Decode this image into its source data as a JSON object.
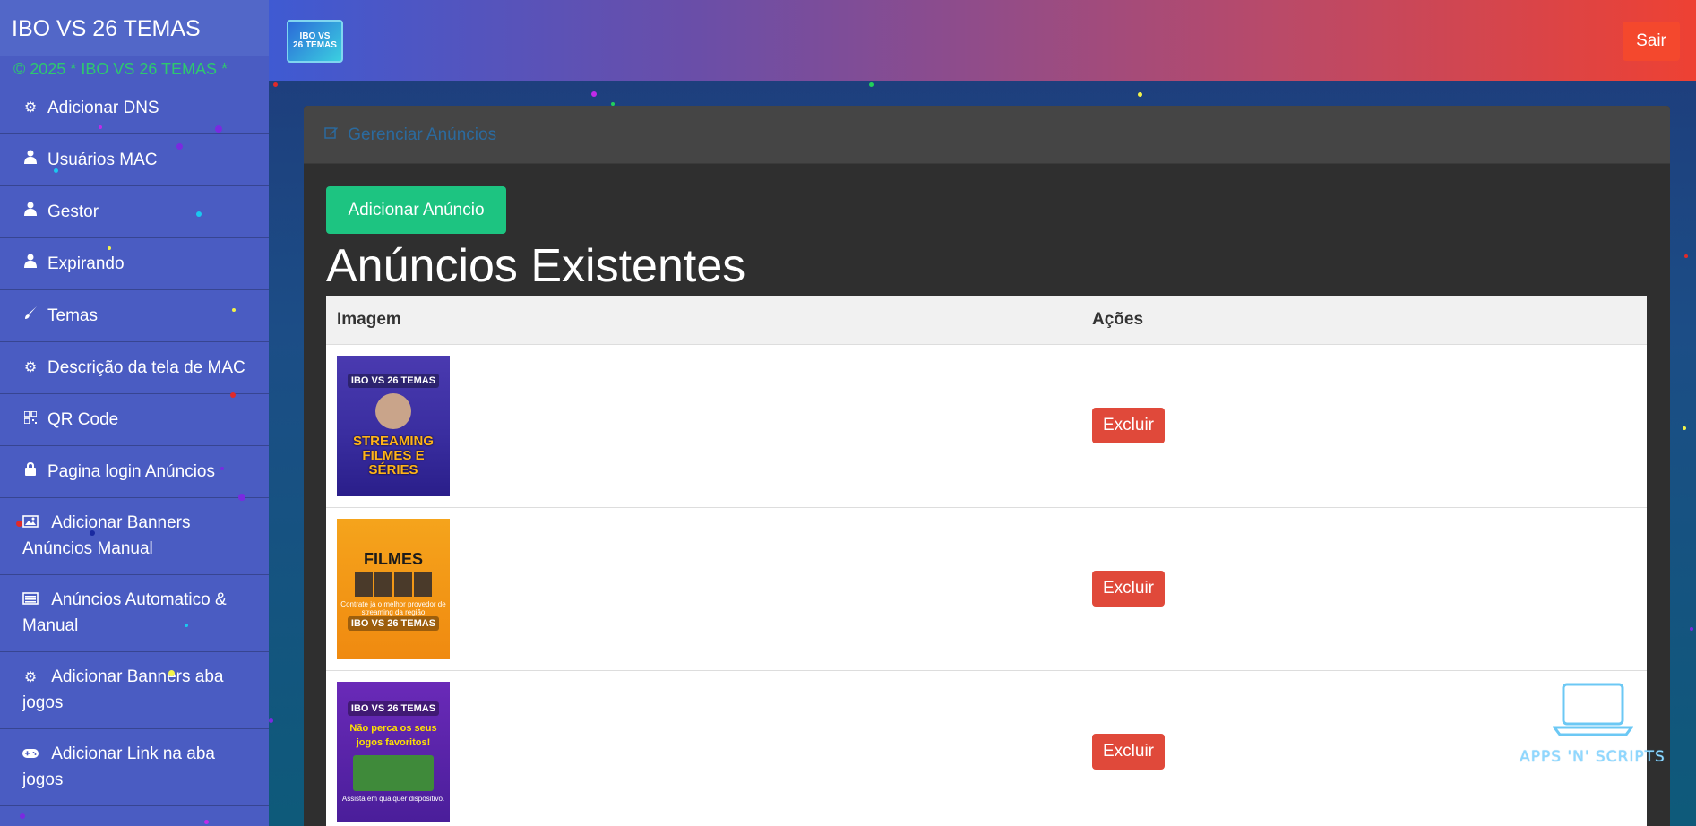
{
  "sidebar": {
    "brand_title": "IBO VS 26 TEMAS",
    "copyright": "© 2025 * IBO VS 26 TEMAS *",
    "items": [
      {
        "label": "Adicionar DNS",
        "icon": "gears-icon"
      },
      {
        "label": "Usuários MAC",
        "icon": "user-icon"
      },
      {
        "label": "Gestor",
        "icon": "user-icon"
      },
      {
        "label": "Expirando",
        "icon": "user-icon"
      },
      {
        "label": "Temas",
        "icon": "brush-icon"
      },
      {
        "label": "Descrição da tela de MAC",
        "icon": "gear-icon"
      },
      {
        "label": "QR Code",
        "icon": "qrcode-icon"
      },
      {
        "label": "Pagina login Anúncios",
        "icon": "lock-icon"
      },
      {
        "label": "Adicionar Banners Anúncios Manual",
        "icon": "image-icon"
      },
      {
        "label": "Anúncios Automatico & Manual",
        "icon": "list-icon"
      },
      {
        "label": "Adicionar Banners aba jogos",
        "icon": "gears-icon"
      },
      {
        "label": "Adicionar Link na aba jogos",
        "icon": "gamepad-icon"
      }
    ]
  },
  "topbar": {
    "logo_text_line1": "IBO VS",
    "logo_text_line2": "26 TEMAS",
    "logout_label": "Sair"
  },
  "panel": {
    "heading": "Gerenciar Anúncios",
    "add_button_label": "Adicionar Anúncio",
    "section_title": "Anúncios Existentes",
    "table": {
      "columns": [
        "Imagem",
        "Ações"
      ],
      "rows": [
        {
          "thumb_brand": "IBO VS 26 TEMAS",
          "thumb_main": "STREAMING FILMES E SÉRIES",
          "action_label": "Excluir"
        },
        {
          "thumb_brand": "IBO VS 26 TEMAS",
          "thumb_main": "FILMES",
          "thumb_sub": "Contrate já o melhor provedor de streaming da região",
          "action_label": "Excluir"
        },
        {
          "thumb_brand": "IBO VS 26 TEMAS",
          "thumb_main": "Não perca os seus jogos favoritos!",
          "thumb_sub": "Assista em qualquer dispositivo.",
          "action_label": "Excluir"
        }
      ]
    }
  },
  "watermark": {
    "text": "APPS 'N' SCRIPTS"
  },
  "colors": {
    "sidebar_bg": "#4a5cc2",
    "copyright_green": "#2ec86f",
    "logout_red": "#f4482d",
    "add_green": "#1dc481",
    "delete_red": "#e0493a",
    "panel_bg": "#2f2f2f"
  }
}
